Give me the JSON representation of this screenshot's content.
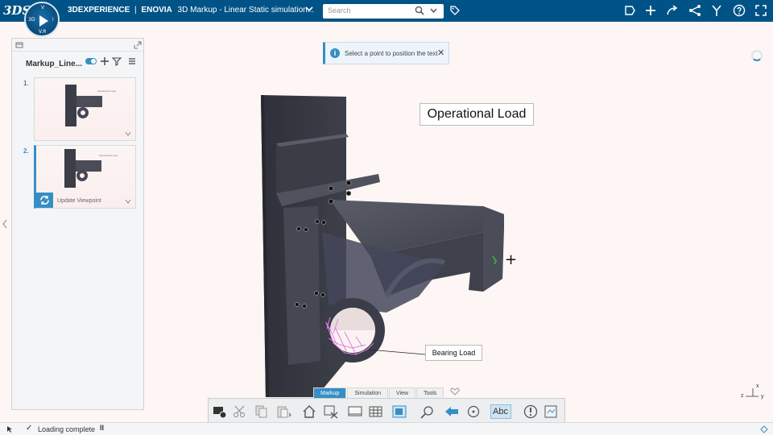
{
  "topbar": {
    "logo": "3DS",
    "compass_labels": [
      "V.R",
      "3D",
      "i"
    ],
    "brand": "3DEXPERIENCE",
    "separator": "|",
    "app": "ENOVIA",
    "doc_title": "3D Markup - Linear Static simulation...",
    "search_placeholder": "Search",
    "right_icons": [
      "share-icon",
      "plus-icon",
      "forward-icon",
      "network-icon",
      "compass-tools-icon",
      "help-icon",
      "fullscreen-icon"
    ],
    "bg_color": "#005386"
  },
  "left_panel": {
    "title": "Markup_Line...",
    "thumbnails": [
      {
        "number": "1.",
        "mini_text": "Operational Load"
      },
      {
        "number": "2.",
        "mini_text": "Operational Load",
        "action_label": "Update Viewpoint"
      }
    ]
  },
  "toast": {
    "message": "Select a point to position the text",
    "close": "✕",
    "info": "i"
  },
  "viewport": {
    "labels": {
      "operational_load": "Operational Load",
      "bearing_load": "Bearing Load"
    },
    "cursor": "+",
    "axis": {
      "x": "x",
      "z": "z",
      "y": "y"
    }
  },
  "action_bar": {
    "tabs": [
      "Markup",
      "Simulation",
      "View",
      "Tools"
    ],
    "active_tab": "Markup",
    "text_tool": "Abc"
  },
  "status": {
    "message": "Loading complete",
    "check": "✓",
    "pause": "II"
  },
  "colors": {
    "accent": "#368ec4",
    "part": "#3f414c"
  }
}
